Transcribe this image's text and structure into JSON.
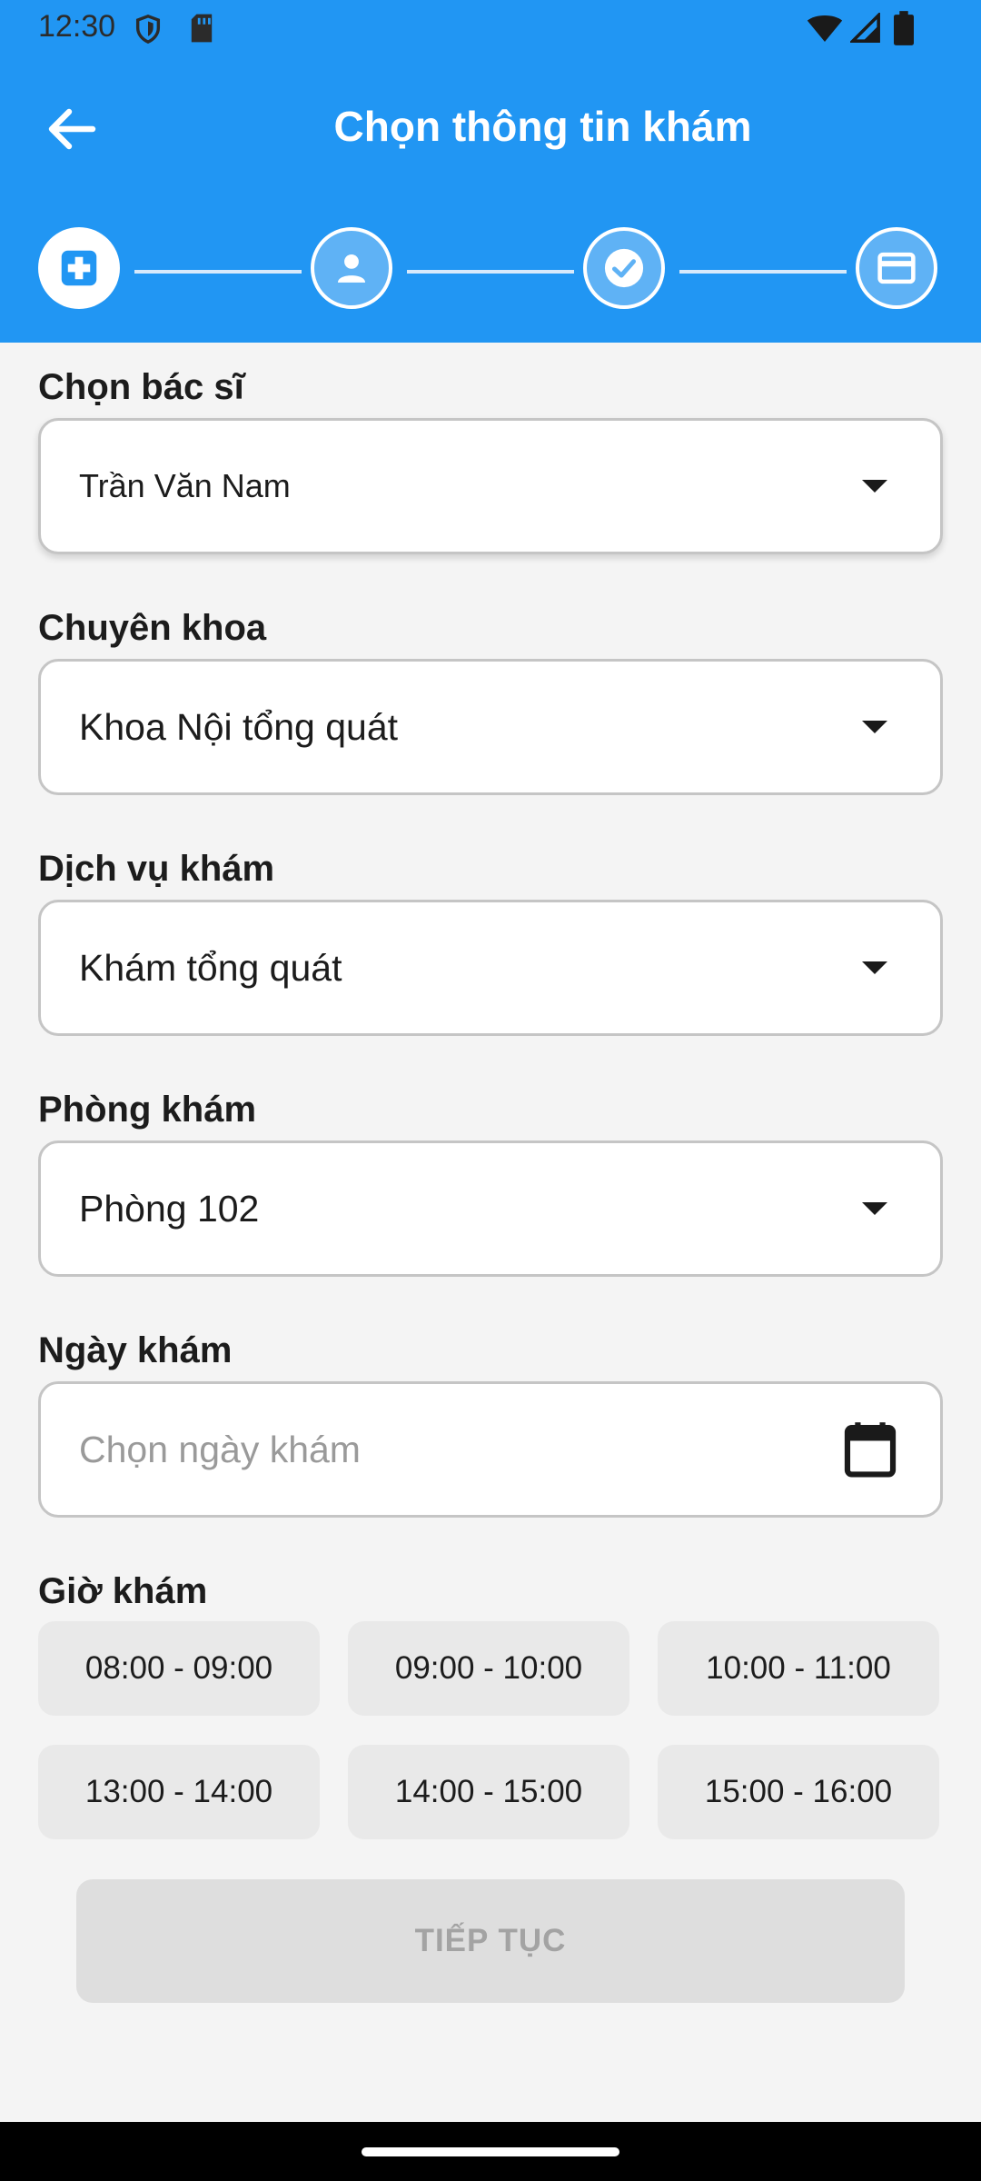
{
  "status_bar": {
    "time": "12:30"
  },
  "appbar": {
    "title": "Chọn thông tin khám",
    "back_icon": "arrow-left-icon"
  },
  "stepper": {
    "steps": [
      {
        "icon": "medical-cross-icon",
        "state": "active"
      },
      {
        "icon": "person-icon",
        "state": "inactive"
      },
      {
        "icon": "check-circle-icon",
        "state": "inactive"
      },
      {
        "icon": "credit-card-icon",
        "state": "inactive"
      }
    ]
  },
  "form": {
    "doctor": {
      "label": "Chọn bác sĩ",
      "value": "Trần Văn Nam"
    },
    "specialty": {
      "label": "Chuyên khoa",
      "value": "Khoa Nội tổng quát"
    },
    "service": {
      "label": "Dịch vụ khám",
      "value": "Khám tổng quát"
    },
    "room": {
      "label": "Phòng khám",
      "value": "Phòng 102"
    },
    "date": {
      "label": "Ngày khám",
      "placeholder": "Chọn ngày khám"
    },
    "time": {
      "label": "Giờ khám",
      "slots": [
        "08:00 - 09:00",
        "09:00 - 10:00",
        "10:00 - 11:00",
        "13:00 - 14:00",
        "14:00 - 15:00",
        "15:00 - 16:00"
      ]
    }
  },
  "continue_button": {
    "label": "TIẾP TỤC",
    "state": "disabled"
  },
  "colors": {
    "primary": "#2196f3",
    "background": "#f4f4f4",
    "slot_background": "#e9e9e9",
    "disabled_button": "#dedede"
  }
}
